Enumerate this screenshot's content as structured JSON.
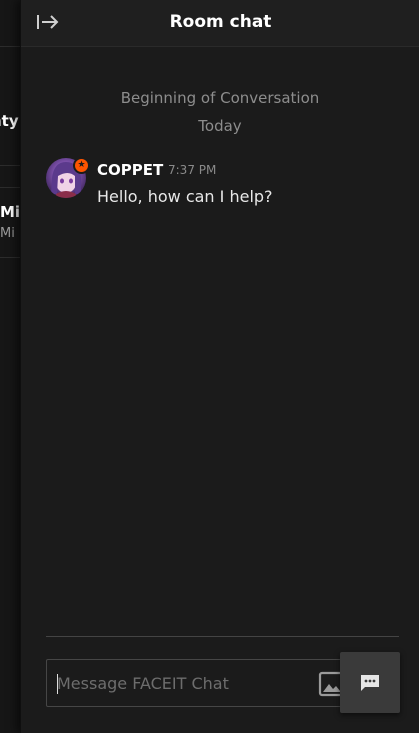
{
  "background": {
    "line1": "nty",
    "line2": "Mi",
    "line3": "Mi"
  },
  "header": {
    "title": "Room chat",
    "collapse_icon": "collapse-right-icon"
  },
  "conversation": {
    "beginning": "Beginning of Conversation",
    "day": "Today"
  },
  "messages": [
    {
      "author": "COPPET",
      "time": "7:37 PM",
      "text": "Hello, how can I help?",
      "badge_icon": "star-icon"
    }
  ],
  "composer": {
    "placeholder": "Message FACEIT Chat",
    "image_icon": "image-icon",
    "send_icon": "chat-bubble-icon"
  },
  "colors": {
    "accent": "#ff5500",
    "background": "#1b1b1b"
  }
}
